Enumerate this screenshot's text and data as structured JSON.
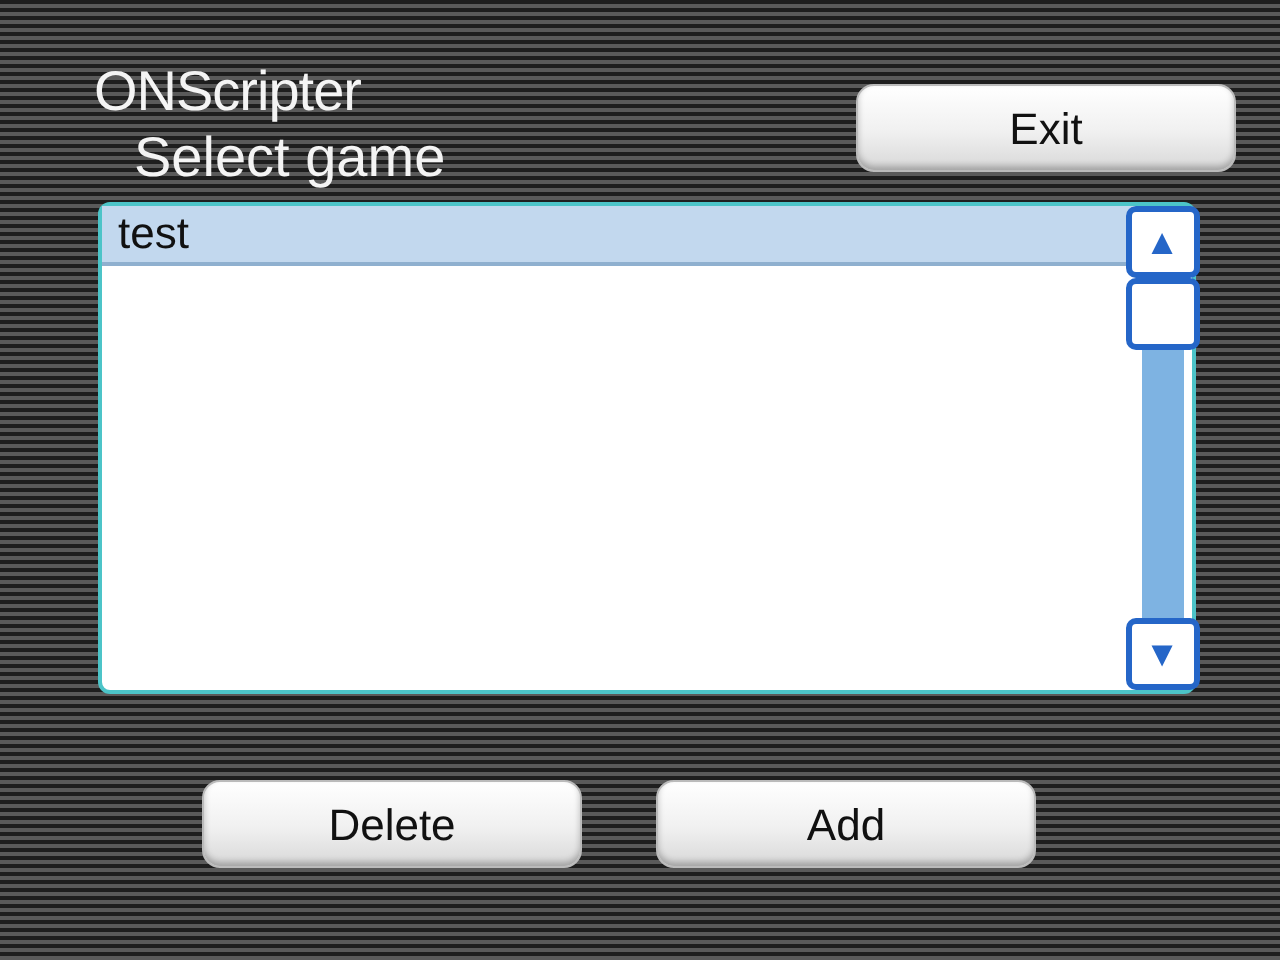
{
  "title": "ONScripter",
  "subtitle": "Select game",
  "exit_button": "Exit",
  "games": [
    {
      "label": "test",
      "selected": true
    }
  ],
  "scrollbar": {
    "up": "▲",
    "down": "▼"
  },
  "buttons": [
    "Delete",
    "Add"
  ]
}
